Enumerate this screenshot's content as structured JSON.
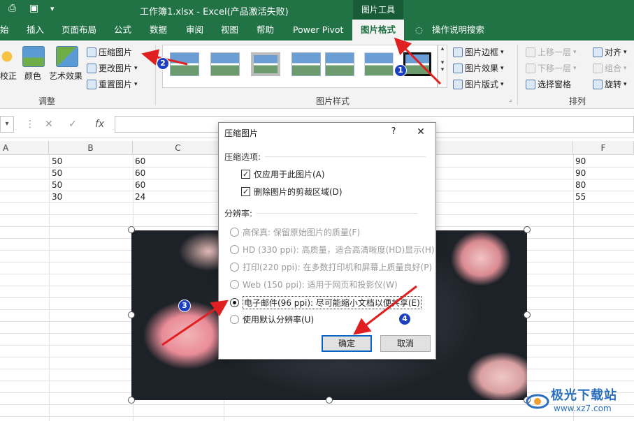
{
  "titlebar": {
    "title": "工作簿1.xlsx  -  Excel(产品激活失败)",
    "context_group": "图片工具"
  },
  "tabs": [
    {
      "label": "始"
    },
    {
      "label": "插入"
    },
    {
      "label": "页面布局"
    },
    {
      "label": "公式"
    },
    {
      "label": "数据"
    },
    {
      "label": "审阅"
    },
    {
      "label": "视图"
    },
    {
      "label": "帮助"
    },
    {
      "label": "Power Pivot"
    },
    {
      "label": "图片格式"
    },
    {
      "label": "操作说明搜索"
    }
  ],
  "ribbon": {
    "adjust": {
      "correct": "校正",
      "color": "颜色",
      "artistic": "艺术效果",
      "compress": "压缩图片",
      "change": "更改图片",
      "reset": "重置图片",
      "group_label": "调整"
    },
    "styles": {
      "border": "图片边框",
      "effects": "图片效果",
      "layout": "图片版式",
      "group_label": "图片样式"
    },
    "arrange": {
      "bring_forward": "上移一层",
      "send_backward": "下移一层",
      "selection_pane": "选择窗格",
      "align": "对齐",
      "group": "组合",
      "rotate": "旋转",
      "group_label": "排列"
    }
  },
  "formula_bar": {
    "fx": "fx"
  },
  "sheet": {
    "columns": [
      "A",
      "B",
      "C",
      "F"
    ],
    "rows": [
      [
        "50",
        "60",
        "90"
      ],
      [
        "50",
        "60",
        "90"
      ],
      [
        "50",
        "60",
        "80"
      ],
      [
        "30",
        "24",
        "55"
      ]
    ]
  },
  "dialog": {
    "title": "压缩图片",
    "help": "?",
    "close": "✕",
    "compress_section": "压缩选项:",
    "options": [
      {
        "label": "仅应用于此图片(A)",
        "checked": true
      },
      {
        "label": "删除图片的剪裁区域(D)",
        "checked": true
      }
    ],
    "resolution_section": "分辨率:",
    "resolutions": [
      {
        "label": "高保真: 保留原始图片的质量(F)",
        "enabled": false,
        "selected": false
      },
      {
        "label": "HD (330 ppi): 高质量，适合高清晰度(HD)显示(H)",
        "enabled": false,
        "selected": false
      },
      {
        "label": "打印(220 ppi): 在多数打印机和屏幕上质量良好(P)",
        "enabled": false,
        "selected": false
      },
      {
        "label": "Web (150 ppi): 适用于网页和投影仪(W)",
        "enabled": false,
        "selected": false
      },
      {
        "label": "电子邮件(96 ppi): 尽可能缩小文档以便共享(E)",
        "enabled": true,
        "selected": true
      },
      {
        "label": "使用默认分辨率(U)",
        "enabled": true,
        "selected": false
      }
    ],
    "ok": "确定",
    "cancel": "取消"
  },
  "badges": [
    "1",
    "2",
    "3",
    "4"
  ],
  "watermark": {
    "name": "极光下载站",
    "url": "www.xz7.com"
  },
  "colors": {
    "excel_green": "#217346",
    "badge_blue": "#1b3fbf",
    "arrow_red": "#e02020"
  }
}
